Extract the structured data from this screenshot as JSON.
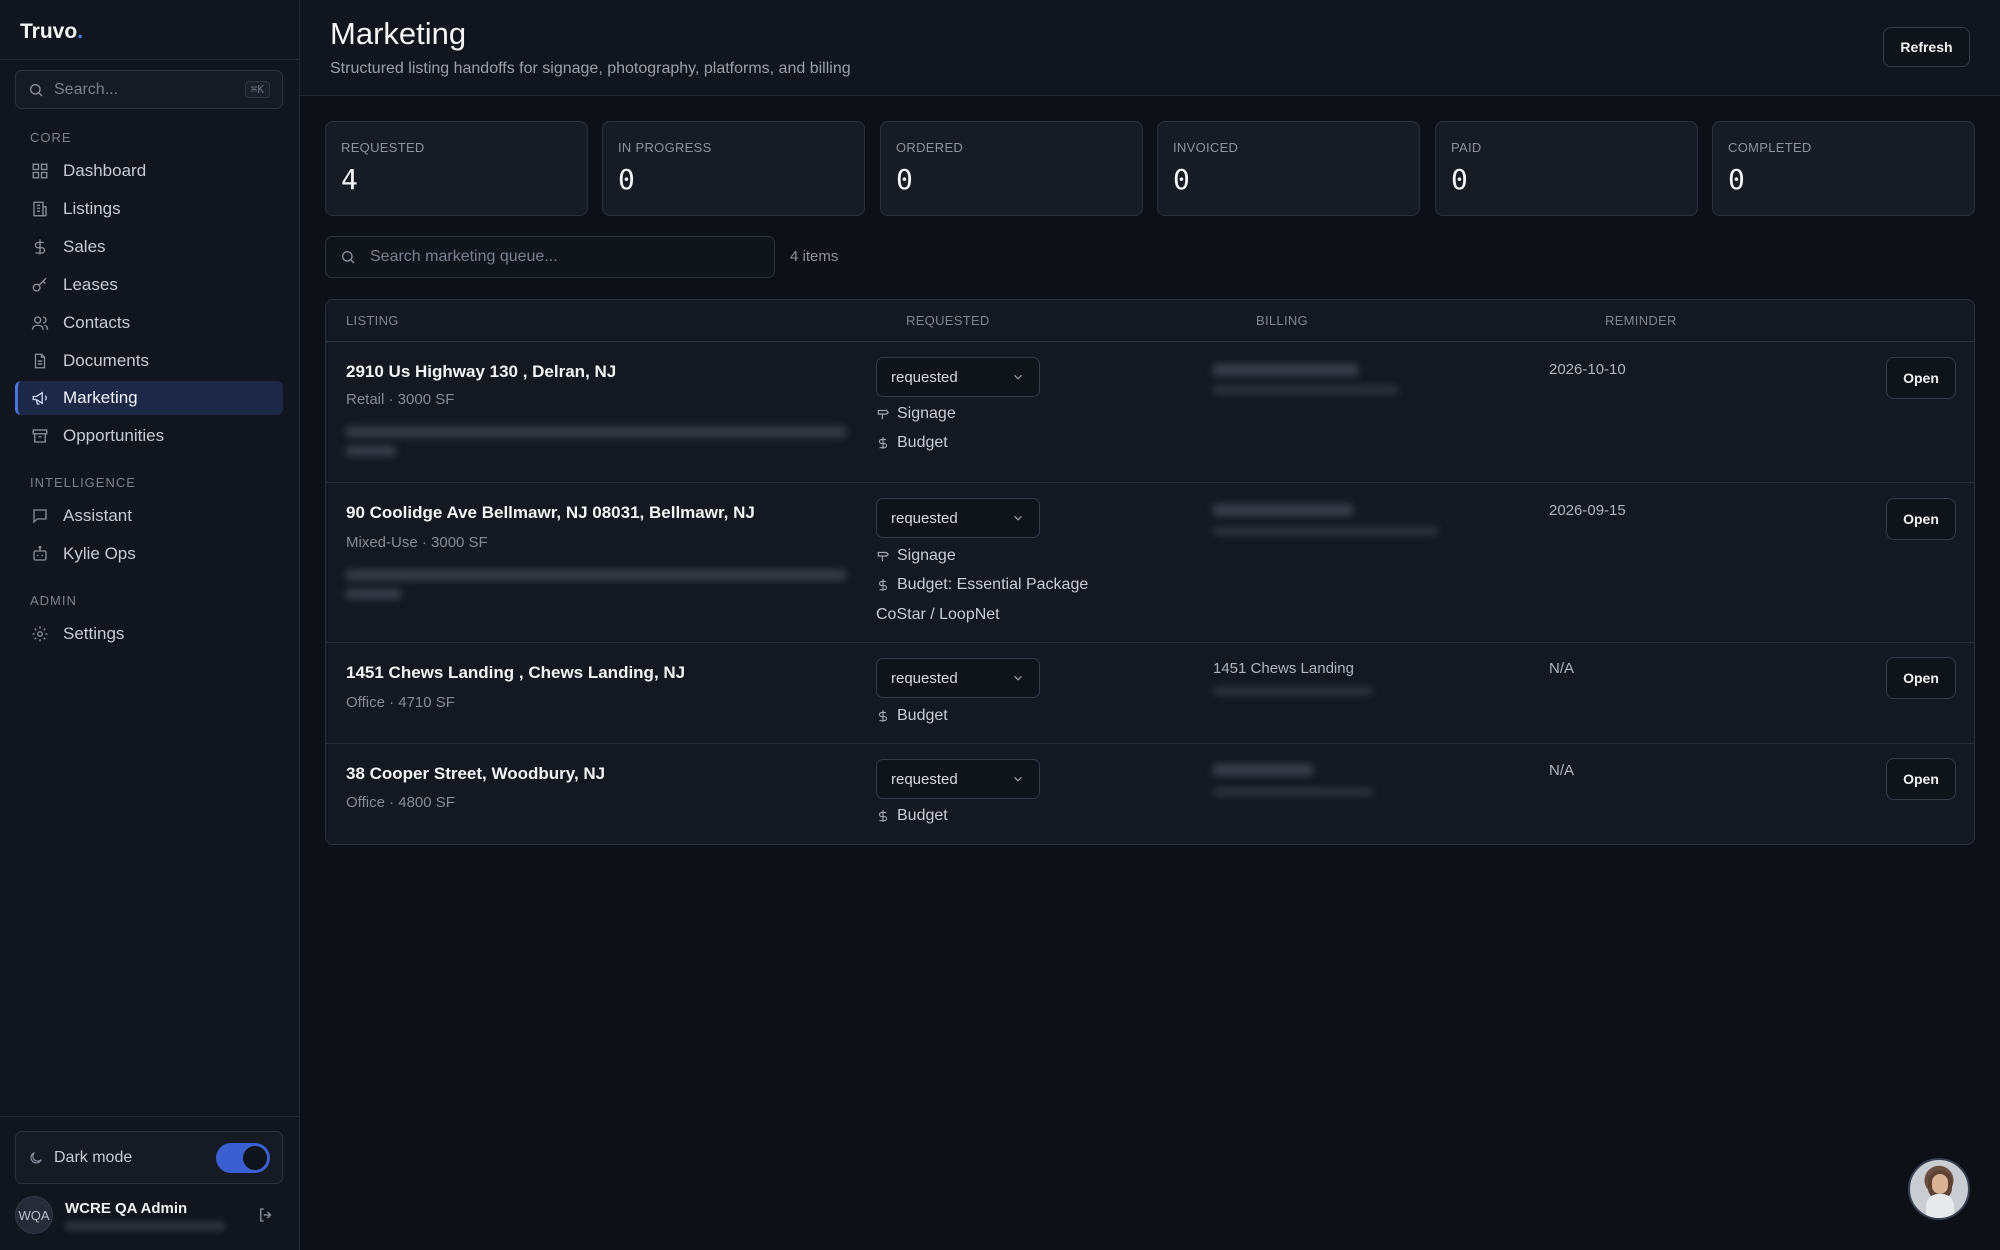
{
  "brand": {
    "name": "Truvo",
    "dot": "."
  },
  "sidebar": {
    "search_placeholder": "Search...",
    "search_shortcut": "⌘K",
    "sections": [
      {
        "label": "CORE"
      },
      {
        "label": "INTELLIGENCE"
      },
      {
        "label": "ADMIN"
      }
    ],
    "items": [
      {
        "label": "Dashboard",
        "icon": "grid-icon"
      },
      {
        "label": "Listings",
        "icon": "building-icon"
      },
      {
        "label": "Sales",
        "icon": "dollar-icon"
      },
      {
        "label": "Leases",
        "icon": "key-icon"
      },
      {
        "label": "Contacts",
        "icon": "users-icon"
      },
      {
        "label": "Documents",
        "icon": "document-icon"
      },
      {
        "label": "Marketing",
        "icon": "megaphone-icon",
        "active": true
      },
      {
        "label": "Opportunities",
        "icon": "archive-icon"
      },
      {
        "label": "Assistant",
        "icon": "chat-icon"
      },
      {
        "label": "Kylie Ops",
        "icon": "bot-icon"
      },
      {
        "label": "Settings",
        "icon": "gear-icon"
      }
    ],
    "dark_mode_label": "Dark mode",
    "dark_mode_on": true,
    "user": {
      "initials": "WQA",
      "name": "WCRE QA Admin"
    }
  },
  "header": {
    "title": "Marketing",
    "subtitle": "Structured listing handoffs for signage, photography, platforms, and billing",
    "refresh_label": "Refresh"
  },
  "stats": [
    {
      "label": "REQUESTED",
      "value": "4"
    },
    {
      "label": "IN PROGRESS",
      "value": "0"
    },
    {
      "label": "ORDERED",
      "value": "0"
    },
    {
      "label": "INVOICED",
      "value": "0"
    },
    {
      "label": "PAID",
      "value": "0"
    },
    {
      "label": "COMPLETED",
      "value": "0"
    }
  ],
  "queue": {
    "search_placeholder": "Search marketing queue...",
    "count": "4 items"
  },
  "table": {
    "columns": [
      "LISTING",
      "REQUESTED",
      "BILLING",
      "REMINDER"
    ],
    "rows": [
      {
        "address": "2910 Us Highway 130 , Delran, NJ",
        "meta": "Retail · 3000 SF",
        "status": "requested",
        "tags": [
          "Signage",
          "Budget"
        ],
        "billing": "",
        "reminder": "2026-10-10",
        "action": "Open"
      },
      {
        "address": "90 Coolidge Ave Bellmawr, NJ 08031, Bellmawr, NJ",
        "meta": "Mixed-Use · 3000 SF",
        "status": "requested",
        "tags": [
          "Signage",
          "Budget: Essential Package",
          "CoStar / LoopNet"
        ],
        "billing": "",
        "reminder": "2026-09-15",
        "action": "Open"
      },
      {
        "address": "1451 Chews Landing , Chews Landing, NJ",
        "meta": "Office · 4710 SF",
        "status": "requested",
        "tags": [
          "Budget"
        ],
        "billing": "1451 Chews Landing",
        "reminder": "N/A",
        "action": "Open"
      },
      {
        "address": "38 Cooper Street, Woodbury, NJ",
        "meta": "Office · 4800 SF",
        "status": "requested",
        "tags": [
          "Budget"
        ],
        "billing": "",
        "reminder": "N/A",
        "action": "Open"
      }
    ]
  }
}
